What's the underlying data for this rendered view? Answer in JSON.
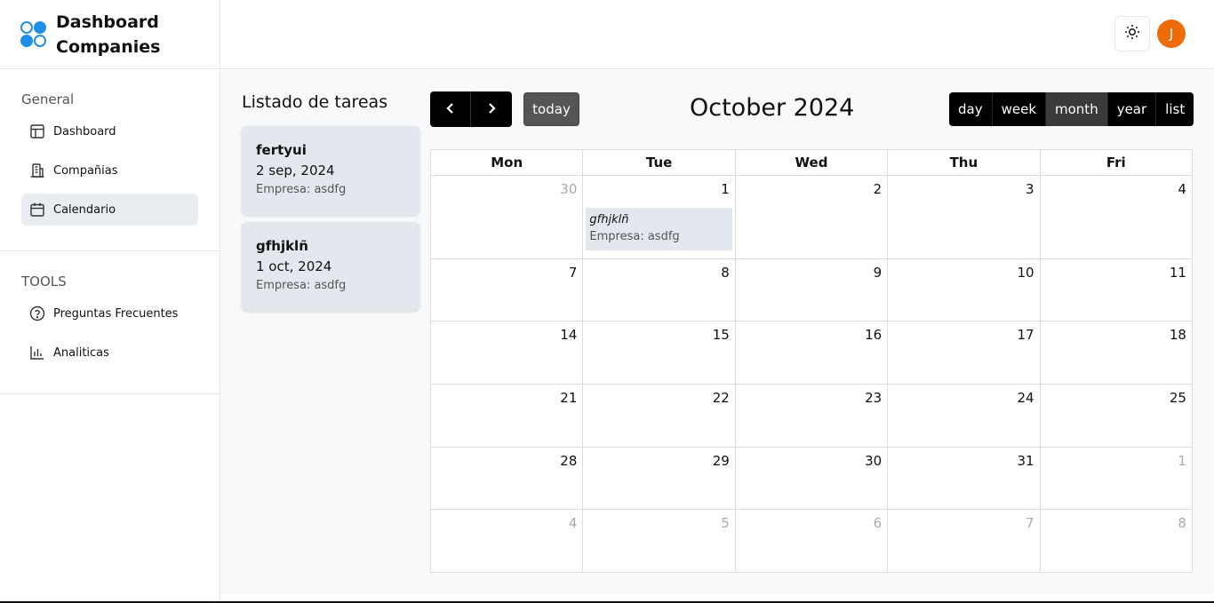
{
  "brand": {
    "line1": "Dashboard",
    "line2": "Companies",
    "logo_icon": "logo-icon"
  },
  "sidebar": {
    "general_title": "General",
    "general_items": [
      {
        "label": "Dashboard",
        "icon": "layout-icon"
      },
      {
        "label": "Compañias",
        "icon": "building-icon"
      },
      {
        "label": "Calendario",
        "icon": "calendar-icon",
        "active": true
      }
    ],
    "tools_title": "TOOLS",
    "tools_items": [
      {
        "label": "Preguntas Frecuentes",
        "icon": "help-circle-icon"
      },
      {
        "label": "Analiticas",
        "icon": "bar-chart-icon"
      }
    ]
  },
  "header": {
    "theme_icon": "sun-icon",
    "avatar_initial": "J",
    "avatar_color": "#ee6b0a"
  },
  "tasks": {
    "title": "Listado de tareas",
    "items": [
      {
        "name": "fertyui",
        "date": "2 sep, 2024",
        "company": "Empresa: asdfg"
      },
      {
        "name": "gfhjklñ",
        "date": "1 oct, 2024",
        "company": "Empresa: asdfg"
      }
    ]
  },
  "calendar": {
    "title": "October 2024",
    "today_label": "today",
    "prev_icon": "chevron-left-icon",
    "next_icon": "chevron-right-icon",
    "views": [
      "day",
      "week",
      "month",
      "year",
      "list"
    ],
    "active_view": "month",
    "weekdays": [
      "Mon",
      "Tue",
      "Wed",
      "Thu",
      "Fri"
    ],
    "weeks": [
      [
        {
          "d": "30",
          "other": true
        },
        {
          "d": "1"
        },
        {
          "d": "2"
        },
        {
          "d": "3"
        },
        {
          "d": "4"
        }
      ],
      [
        {
          "d": "7"
        },
        {
          "d": "8"
        },
        {
          "d": "9"
        },
        {
          "d": "10"
        },
        {
          "d": "11"
        }
      ],
      [
        {
          "d": "14"
        },
        {
          "d": "15"
        },
        {
          "d": "16"
        },
        {
          "d": "17"
        },
        {
          "d": "18"
        }
      ],
      [
        {
          "d": "21"
        },
        {
          "d": "22"
        },
        {
          "d": "23"
        },
        {
          "d": "24"
        },
        {
          "d": "25"
        }
      ],
      [
        {
          "d": "28"
        },
        {
          "d": "29"
        },
        {
          "d": "30"
        },
        {
          "d": "31"
        },
        {
          "d": "1",
          "other": true
        }
      ],
      [
        {
          "d": "4",
          "other": true
        },
        {
          "d": "5",
          "other": true
        },
        {
          "d": "6",
          "other": true
        },
        {
          "d": "7",
          "other": true
        },
        {
          "d": "8",
          "other": true
        }
      ]
    ],
    "event": {
      "title": "gfhjklñ",
      "company": "Empresa: asdfg",
      "week": 0,
      "day": 1
    }
  }
}
